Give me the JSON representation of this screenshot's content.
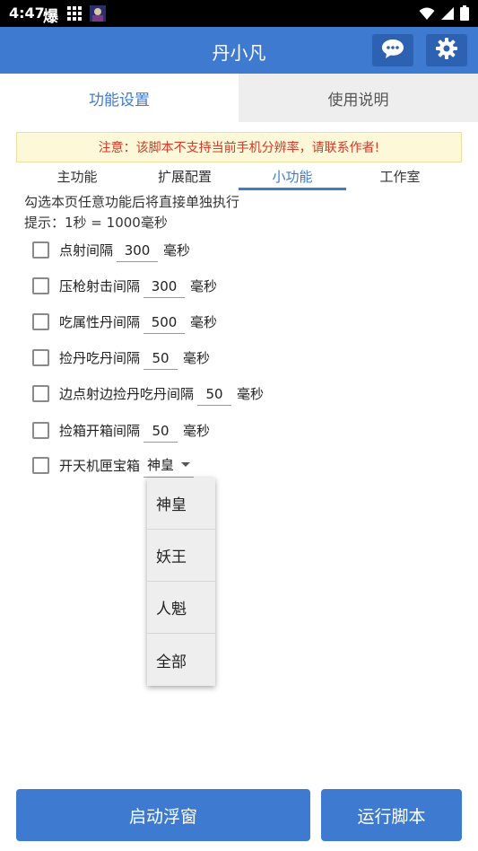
{
  "status_bar": {
    "time": "4:47",
    "notification_glyph": "爆"
  },
  "app_bar": {
    "title": "丹小凡"
  },
  "top_tabs": [
    {
      "label": "功能设置"
    },
    {
      "label": "使用说明"
    }
  ],
  "notice": {
    "text": "注意：该脚本不支持当前手机分辨率，请联系作者!"
  },
  "sub_tabs": [
    {
      "label": "主功能"
    },
    {
      "label": "扩展配置"
    },
    {
      "label": "小功能"
    },
    {
      "label": "工作室"
    }
  ],
  "description": {
    "line1": "勾选本页任意功能后将直接单独执行",
    "line2": "提示：1秒 = 1000毫秒"
  },
  "options": [
    {
      "label": "点射间隔",
      "value": "300",
      "unit": "毫秒"
    },
    {
      "label": "压枪射击间隔",
      "value": "300",
      "unit": "毫秒"
    },
    {
      "label": "吃属性丹间隔",
      "value": "500",
      "unit": "毫秒"
    },
    {
      "label": "捡丹吃丹间隔",
      "value": "50",
      "unit": "毫秒"
    },
    {
      "label": "边点射边捡丹吃丹间隔",
      "value": "50",
      "unit": "毫秒"
    },
    {
      "label": "捡箱开箱间隔",
      "value": "50",
      "unit": "毫秒"
    }
  ],
  "treasure_box": {
    "label": "开天机匣宝箱",
    "selected": "神皇",
    "options": [
      "神皇",
      "妖王",
      "人魁",
      "全部"
    ]
  },
  "buttons": {
    "float_window": "启动浮窗",
    "run_script": "运行脚本"
  },
  "colors": {
    "accent": "#3e7bd0",
    "accent_dark": "#2c62b1",
    "notice_text": "#d23a2a",
    "notice_bg": "#fdf8d8"
  }
}
